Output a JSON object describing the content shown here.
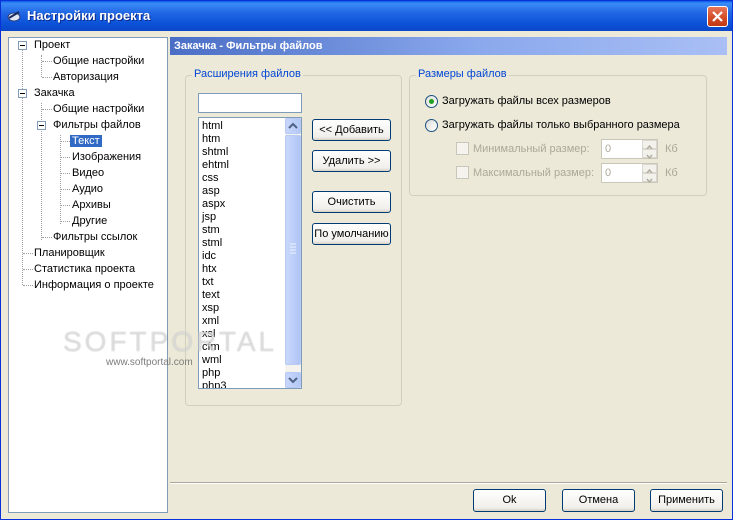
{
  "window": {
    "title": "Настройки проекта",
    "icon": "app-icon"
  },
  "tree": {
    "items": [
      {
        "label": "Проект"
      },
      {
        "label": "Общие настройки"
      },
      {
        "label": "Авторизация"
      },
      {
        "label": "Закачка"
      },
      {
        "label": "Общие настройки"
      },
      {
        "label": "Фильтры файлов"
      },
      {
        "label": "Текст",
        "selected": true
      },
      {
        "label": "Изображения"
      },
      {
        "label": "Видео"
      },
      {
        "label": "Аудио"
      },
      {
        "label": "Архивы"
      },
      {
        "label": "Другие"
      },
      {
        "label": "Фильтры ссылок"
      },
      {
        "label": "Планировщик"
      },
      {
        "label": "Статистика проекта"
      },
      {
        "label": "Информация о проекте"
      }
    ]
  },
  "header": {
    "title": "Закачка - Фильтры файлов"
  },
  "extensions": {
    "group_title": "Расширения файлов",
    "input_value": "",
    "list": [
      "html",
      "htm",
      "shtml",
      "ehtml",
      "css",
      "asp",
      "aspx",
      "jsp",
      "stm",
      "stml",
      "idc",
      "htx",
      "txt",
      "text",
      "xsp",
      "xml",
      "xsl",
      "cfm",
      "wml",
      "php",
      "php3"
    ],
    "buttons": {
      "add": "<< Добавить",
      "remove": "Удалить >>",
      "clear": "Очистить",
      "default": "По умолчанию"
    }
  },
  "sizes": {
    "group_title": "Размеры файлов",
    "radio_all": "Загружать файлы всех размеров",
    "radio_selected": "Загружать файлы только выбранного размера",
    "selected_option": "all",
    "min_label": "Минимальный размер:",
    "min_value": "0",
    "max_label": "Максимальный размер:",
    "max_value": "0",
    "unit": "Кб"
  },
  "watermark": {
    "main": "SOFTPORTAL",
    "sub": "www.softportal.com"
  },
  "footer": {
    "ok": "Ok",
    "cancel": "Отмена",
    "apply": "Применить"
  },
  "colors": {
    "titlebar": "#0a5ee8",
    "selection": "#316ac5",
    "group_title": "#0046d5",
    "radio_dot": "#21a121"
  }
}
